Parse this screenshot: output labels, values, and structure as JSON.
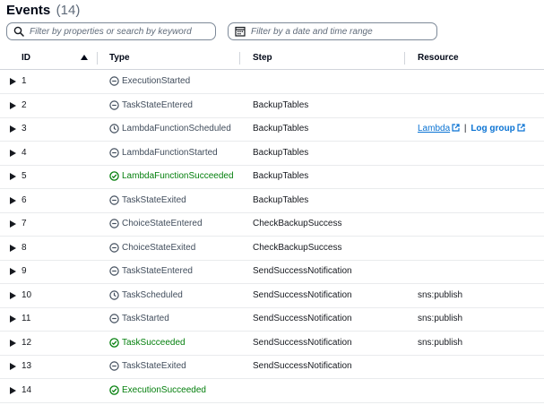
{
  "header": {
    "title": "Events",
    "count": "(14)"
  },
  "filters": {
    "search_placeholder": "Filter by properties or search by keyword",
    "date_placeholder": "Filter by a date and time range"
  },
  "columns": {
    "id": "ID",
    "type": "Type",
    "step": "Step",
    "resource": "Resource"
  },
  "links": {
    "lambda": "Lambda",
    "separator": "|",
    "log_group": "Log group"
  },
  "colors": {
    "success": "#037f0c",
    "link": "#0972d3",
    "neutral": "#414d5c"
  },
  "rows": [
    {
      "id": "1",
      "type": "ExecutionStarted",
      "status": "neutral",
      "icon": "minus-circle-icon",
      "step": "",
      "resource": ""
    },
    {
      "id": "2",
      "type": "TaskStateEntered",
      "status": "neutral",
      "icon": "minus-circle-icon",
      "step": "BackupTables",
      "resource": ""
    },
    {
      "id": "3",
      "type": "LambdaFunctionScheduled",
      "status": "neutral",
      "icon": "clock-icon",
      "step": "BackupTables",
      "resource": ""
    },
    {
      "id": "4",
      "type": "LambdaFunctionStarted",
      "status": "neutral",
      "icon": "minus-circle-icon",
      "step": "BackupTables",
      "resource": ""
    },
    {
      "id": "5",
      "type": "LambdaFunctionSucceeded",
      "status": "success",
      "icon": "check-circle-icon",
      "step": "BackupTables",
      "resource": ""
    },
    {
      "id": "6",
      "type": "TaskStateExited",
      "status": "neutral",
      "icon": "minus-circle-icon",
      "step": "BackupTables",
      "resource": ""
    },
    {
      "id": "7",
      "type": "ChoiceStateEntered",
      "status": "neutral",
      "icon": "minus-circle-icon",
      "step": "CheckBackupSuccess",
      "resource": ""
    },
    {
      "id": "8",
      "type": "ChoiceStateExited",
      "status": "neutral",
      "icon": "minus-circle-icon",
      "step": "CheckBackupSuccess",
      "resource": ""
    },
    {
      "id": "9",
      "type": "TaskStateEntered",
      "status": "neutral",
      "icon": "minus-circle-icon",
      "step": "SendSuccessNotification",
      "resource": ""
    },
    {
      "id": "10",
      "type": "TaskScheduled",
      "status": "neutral",
      "icon": "clock-icon",
      "step": "SendSuccessNotification",
      "resource": "sns:publish"
    },
    {
      "id": "11",
      "type": "TaskStarted",
      "status": "neutral",
      "icon": "minus-circle-icon",
      "step": "SendSuccessNotification",
      "resource": "sns:publish"
    },
    {
      "id": "12",
      "type": "TaskSucceeded",
      "status": "success",
      "icon": "check-circle-icon",
      "step": "SendSuccessNotification",
      "resource": "sns:publish"
    },
    {
      "id": "13",
      "type": "TaskStateExited",
      "status": "neutral",
      "icon": "minus-circle-icon",
      "step": "SendSuccessNotification",
      "resource": ""
    },
    {
      "id": "14",
      "type": "ExecutionSucceeded",
      "status": "success",
      "icon": "check-circle-icon",
      "step": "",
      "resource": ""
    }
  ]
}
